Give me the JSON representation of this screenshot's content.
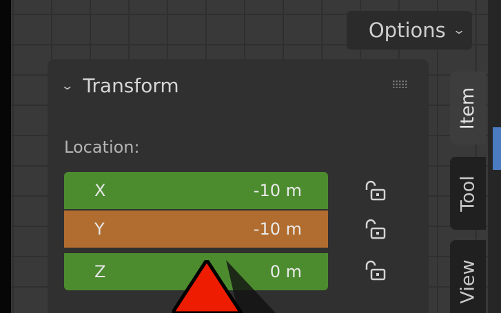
{
  "header": {
    "options_label": "Options",
    "options_icon": "chevron-down-icon"
  },
  "panel": {
    "title": "Transform",
    "collapse_icon": "chevron-down-icon",
    "location_label": "Location:",
    "fields": [
      {
        "axis": "X",
        "value": "-10 m",
        "color": "#4c8c2f",
        "lock_icon": "unlocked-padlock-icon"
      },
      {
        "axis": "Y",
        "value": "-10 m",
        "color": "#b16d2f",
        "lock_icon": "unlocked-padlock-icon"
      },
      {
        "axis": "Z",
        "value": "0 m",
        "color": "#4c8c2f",
        "lock_icon": "unlocked-padlock-icon"
      }
    ]
  },
  "tabs": [
    {
      "label": "Item",
      "active": true
    },
    {
      "label": "Tool",
      "active": false
    },
    {
      "label": "View",
      "active": false
    }
  ],
  "colors": {
    "viewport_bg": "#393939",
    "panel_bg": "#303030",
    "x_field": "#4c8c2f",
    "y_field": "#b16d2f",
    "z_field": "#4c8c2f",
    "cursor_fill": "#ee1c00",
    "tab_accent": "#4a7bc1"
  }
}
